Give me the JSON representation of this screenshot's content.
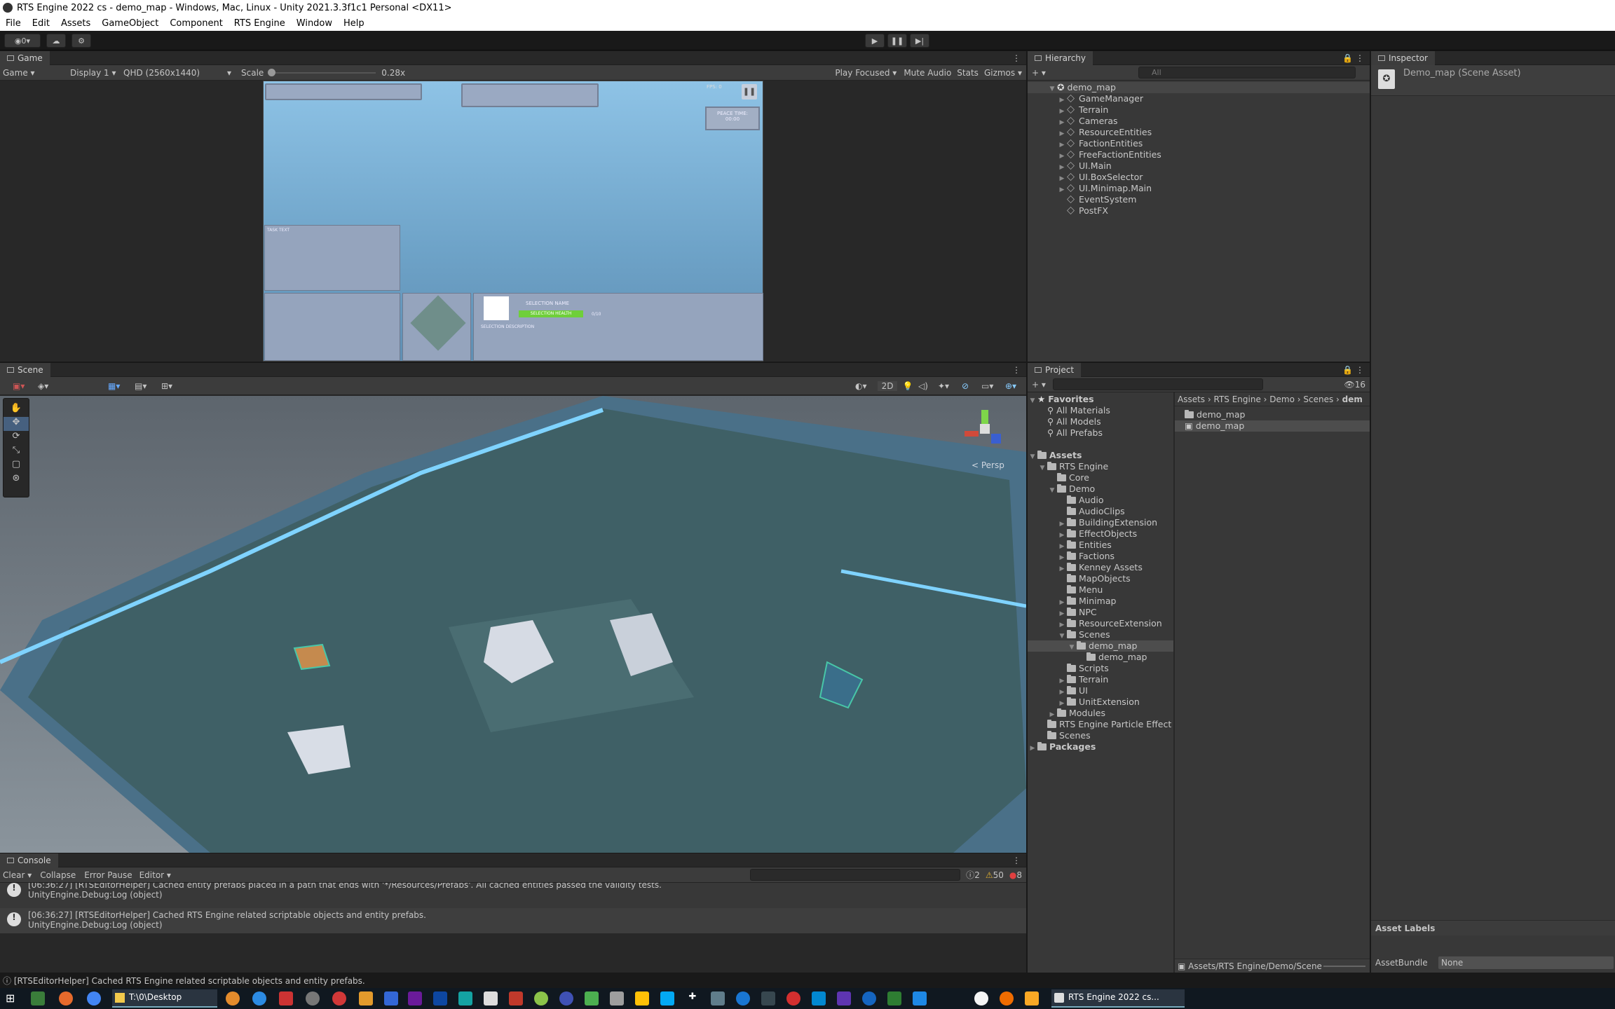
{
  "window": {
    "title": "RTS Engine 2022 cs - demo_map - Windows, Mac, Linux - Unity 2021.3.3f1c1 Personal <DX11>"
  },
  "menu": [
    "File",
    "Edit",
    "Assets",
    "GameObject",
    "Component",
    "RTS Engine",
    "Window",
    "Help"
  ],
  "toolbar": {
    "account": "0",
    "play_icon": "play-icon",
    "pause_icon": "pause-icon",
    "step_icon": "step-icon"
  },
  "game": {
    "tab": "Game",
    "mode": "Game",
    "display": "Display 1",
    "resolution": "QHD (2560x1440)",
    "scale_label": "Scale",
    "scale_value": "0.28x",
    "play_focused": "Play Focused",
    "mute": "Mute Audio",
    "stats": "Stats",
    "gizmos": "Gizmos",
    "fps": "FPS: 0",
    "peace_label": "PEACE TIME:",
    "peace_time": "00:00",
    "task_text": "TASK TEXT",
    "selection_name": "SELECTION NAME",
    "selection_health": "SELECTION HEALTH",
    "health_value": "0/10",
    "selection_desc": "SELECTION DESCRIPTION"
  },
  "scene": {
    "tab": "Scene",
    "view_2d": "2D",
    "persp": "< Persp"
  },
  "hierarchy": {
    "tab": "Hierarchy",
    "search_placeholder": "All",
    "root": "demo_map",
    "items": [
      "GameManager",
      "Terrain",
      "Cameras",
      "ResourceEntities",
      "FactionEntities",
      "FreeFactionEntities",
      "UI.Main",
      "UI.BoxSelector",
      "UI.Minimap.Main",
      "EventSystem",
      "PostFX"
    ]
  },
  "inspector": {
    "tab": "Inspector",
    "title": "Demo_map (Scene Asset)",
    "asset_labels": "Asset Labels",
    "assetbundle_label": "AssetBundle",
    "assetbundle_value": "None"
  },
  "project": {
    "tab": "Project",
    "hidden_count": "16",
    "favorites": "Favorites",
    "fav_items": [
      "All Materials",
      "All Models",
      "All Prefabs"
    ],
    "assets": "Assets",
    "rts": "RTS Engine",
    "core": "Core",
    "demo": "Demo",
    "demo_children": [
      "Audio",
      "AudioClips",
      "BuildingExtension",
      "EffectObjects",
      "Entities",
      "Factions",
      "Kenney Assets",
      "MapObjects",
      "Menu",
      "Minimap",
      "NPC",
      "ResourceExtension"
    ],
    "scenes": "Scenes",
    "demo_map_folder": "demo_map",
    "demo_map_file": "demo_map",
    "after_scenes": [
      "Scripts",
      "Terrain",
      "UI",
      "UnitExtension"
    ],
    "modules": "Modules",
    "particle": "RTS Engine Particle Effect V",
    "root_scenes": "Scenes",
    "packages": "Packages",
    "breadcrumb": [
      "Assets",
      "RTS Engine",
      "Demo",
      "Scenes",
      "dem"
    ],
    "files": [
      "demo_map",
      "demo_map"
    ],
    "footer_path": "Assets/RTS Engine/Demo/Scene"
  },
  "console": {
    "tab": "Console",
    "clear": "Clear",
    "collapse": "Collapse",
    "error_pause": "Error Pause",
    "editor": "Editor",
    "info_count": "2",
    "warn_count": "50",
    "error_count": "8",
    "logs": [
      {
        "l1": "[06:36:27] [RTSEditorHelper] Cached entity prefabs placed in a path that ends with '*/Resources/Prefabs'. All cached entities passed the validity tests.",
        "l2": "UnityEngine.Debug:Log (object)"
      },
      {
        "l1": "[06:36:27] [RTSEditorHelper] Cached RTS Engine related scriptable objects and entity prefabs.",
        "l2": "UnityEngine.Debug:Log (object)"
      }
    ],
    "status": "[RTSEditorHelper] Cached RTS Engine related scriptable objects and entity prefabs."
  },
  "taskbar": {
    "explorer": "T:\\0\\Desktop",
    "unity": "RTS Engine 2022 cs..."
  }
}
